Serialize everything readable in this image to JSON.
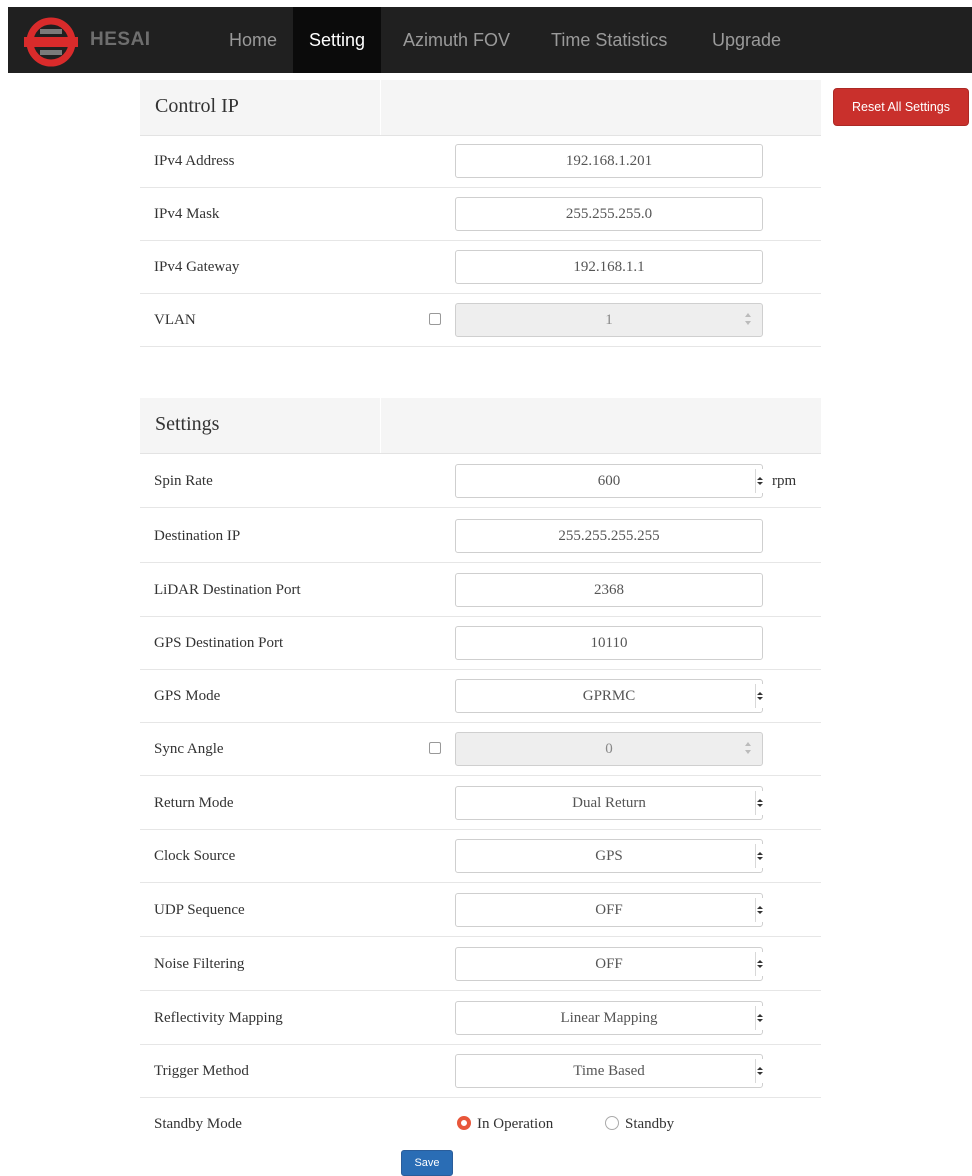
{
  "nav": {
    "brand": "HESAI",
    "items": [
      "Home",
      "Setting",
      "Azimuth FOV",
      "Time Statistics",
      "Upgrade"
    ],
    "active": "Setting"
  },
  "reset_button": "Reset All Settings",
  "control_ip": {
    "title": "Control IP",
    "rows": [
      {
        "label": "IPv4 Address",
        "value": "192.168.1.201"
      },
      {
        "label": "IPv4 Mask",
        "value": "255.255.255.0"
      },
      {
        "label": "IPv4 Gateway",
        "value": "192.168.1.1"
      },
      {
        "label": "VLAN",
        "value": "1",
        "checked": false
      }
    ]
  },
  "settings": {
    "title": "Settings",
    "spin_rate": {
      "label": "Spin Rate",
      "value": "600",
      "unit": "rpm"
    },
    "destination_ip": {
      "label": "Destination IP",
      "value": "255.255.255.255"
    },
    "lidar_port": {
      "label": "LiDAR Destination Port",
      "value": "2368"
    },
    "gps_port": {
      "label": "GPS Destination Port",
      "value": "10110"
    },
    "gps_mode": {
      "label": "GPS Mode",
      "value": "GPRMC"
    },
    "sync_angle": {
      "label": "Sync Angle",
      "value": "0",
      "checked": false
    },
    "return_mode": {
      "label": "Return Mode",
      "value": "Dual Return"
    },
    "clock_source": {
      "label": "Clock Source",
      "value": "GPS"
    },
    "udp_sequence": {
      "label": "UDP Sequence",
      "value": "OFF"
    },
    "noise_filtering": {
      "label": "Noise Filtering",
      "value": "OFF"
    },
    "reflectivity_mapping": {
      "label": "Reflectivity Mapping",
      "value": "Linear Mapping"
    },
    "trigger_method": {
      "label": "Trigger Method",
      "value": "Time Based"
    },
    "standby_mode": {
      "label": "Standby Mode",
      "options": [
        "In Operation",
        "Standby"
      ],
      "selected": "In Operation"
    }
  },
  "save_button": "Save",
  "colors": {
    "navbar": "#202020",
    "reset": "#c9302c",
    "save": "#2a6db5",
    "radio_on": "#e8563a"
  }
}
